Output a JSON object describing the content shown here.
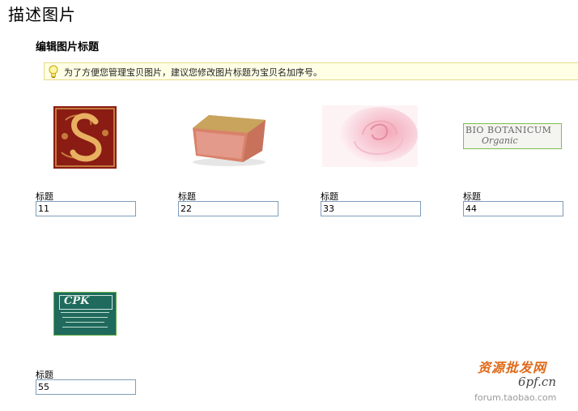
{
  "page": {
    "title": "描述图片",
    "section_title": "编辑图片标题",
    "tip": "为了方便您管理宝贝图片，建议您修改图片标题为宝贝名加序号。"
  },
  "items": [
    {
      "label": "标题",
      "value": "11",
      "thumb": "ornate-letter-s-image"
    },
    {
      "label": "标题",
      "value": "22",
      "thumb": "soap-bar-image"
    },
    {
      "label": "标题",
      "value": "33",
      "thumb": "pink-rose-image"
    },
    {
      "label": "标题",
      "value": "44",
      "thumb": "bio-botanicum-logo-image",
      "thumb_text_1": "BIO BOTANICUM",
      "thumb_text_2": "Organic"
    },
    {
      "label": "标题",
      "value": "55",
      "thumb": "cpk-certificate-image",
      "thumb_text_1": "CPK"
    }
  ],
  "watermark": {
    "line1": "资源批发网",
    "line2": "6pf.cn",
    "line3": "forum.taobao.com"
  },
  "colors": {
    "tip_background": "#ffffe6",
    "tip_border": "#e8d98a",
    "input_border": "#7f9db9"
  }
}
